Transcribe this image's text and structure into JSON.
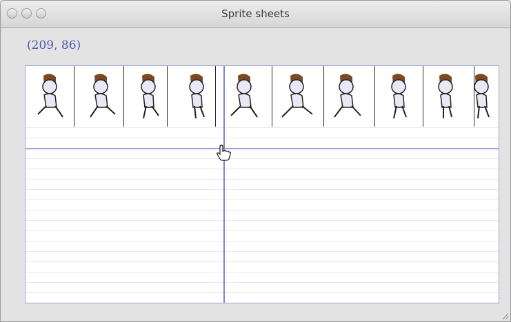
{
  "window": {
    "title": "Sprite sheets"
  },
  "readout": {
    "coordinates": "(209, 86)"
  },
  "sprite_sheet": {
    "frame_count": 10,
    "icon": "running-character-sprite"
  },
  "cursor": {
    "icon": "hand-pointer-icon"
  },
  "colors": {
    "coords_text": "#4a58b0",
    "guide_line": "#7c86cf",
    "hair": "#7a4a25",
    "body": "#e9e9f6"
  }
}
